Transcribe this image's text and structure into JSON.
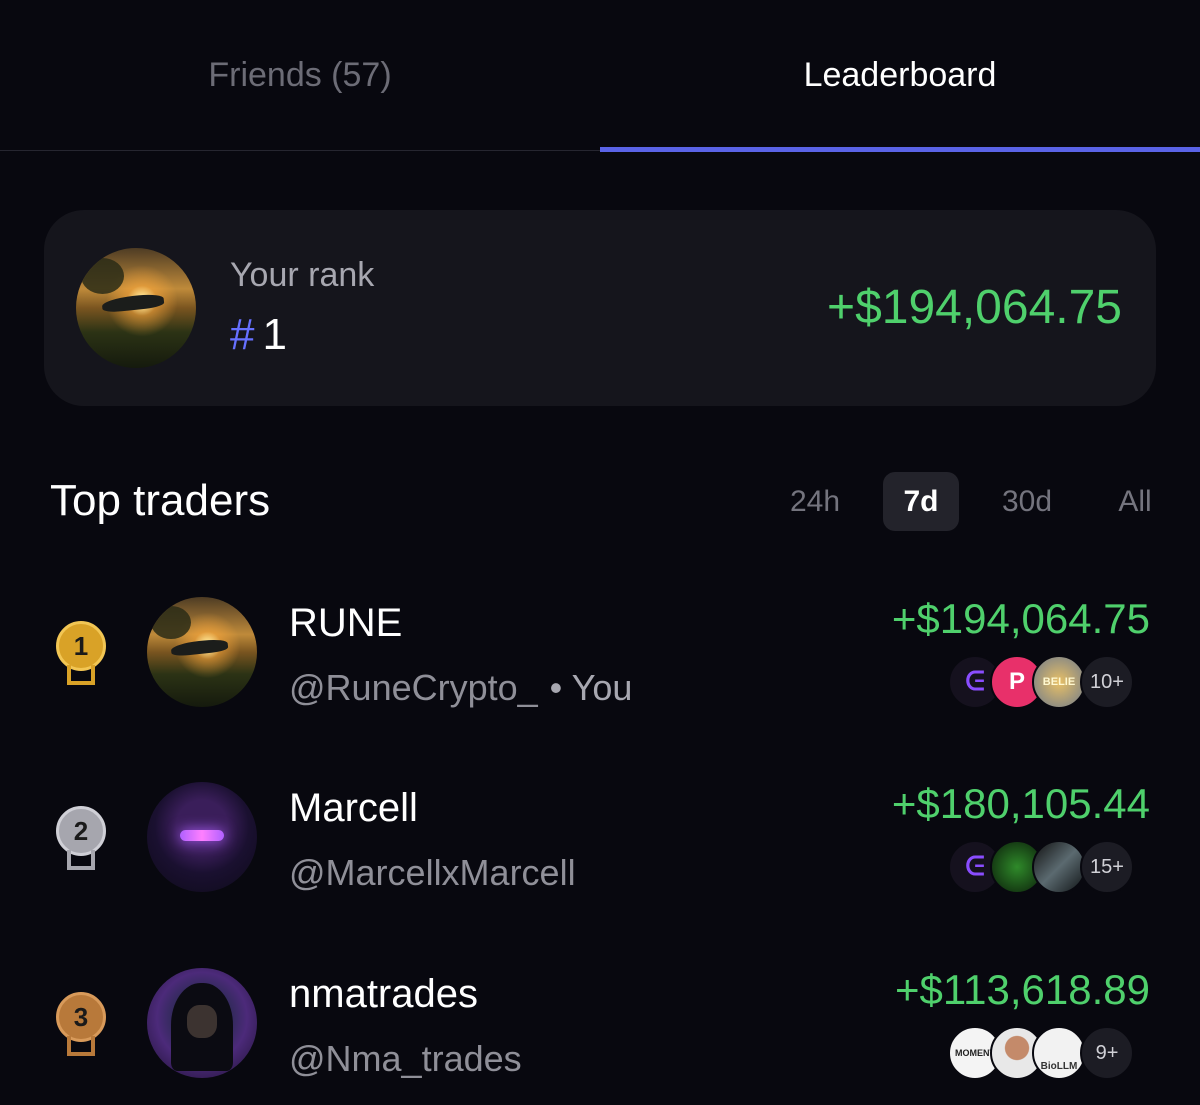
{
  "tabs": {
    "friends": "Friends (57)",
    "leaderboard": "Leaderboard"
  },
  "rank_card": {
    "label": "Your rank",
    "hash": "#",
    "rank": "1",
    "pnl": "+$194,064.75"
  },
  "top_traders": {
    "title": "Top traders",
    "ranges": [
      "24h",
      "7d",
      "30d",
      "All"
    ],
    "selected_range": "7d"
  },
  "traders": [
    {
      "rank": "1",
      "name": "RUNE",
      "handle": "@RuneCrypto_",
      "you_label": "• You",
      "pnl": "+$194,064.75",
      "more": "10+",
      "medal_color": "#d9a227"
    },
    {
      "rank": "2",
      "name": "Marcell",
      "handle": "@MarcellxMarcell",
      "pnl": "+$180,105.44",
      "more": "15+",
      "medal_color": "#a6a6ae"
    },
    {
      "rank": "3",
      "name": "nmatrades",
      "handle": "@Nma_trades",
      "pnl": "+$113,618.89",
      "more": "9+",
      "medal_color": "#b8793a"
    }
  ],
  "token_chips": {
    "belief": "BELIE",
    "moment": "MOMENT",
    "biollm": "BioLLM"
  },
  "colors": {
    "background": "#08080f",
    "card": "#15151c",
    "accent": "#5a63e6",
    "profit": "#4fd06c"
  }
}
